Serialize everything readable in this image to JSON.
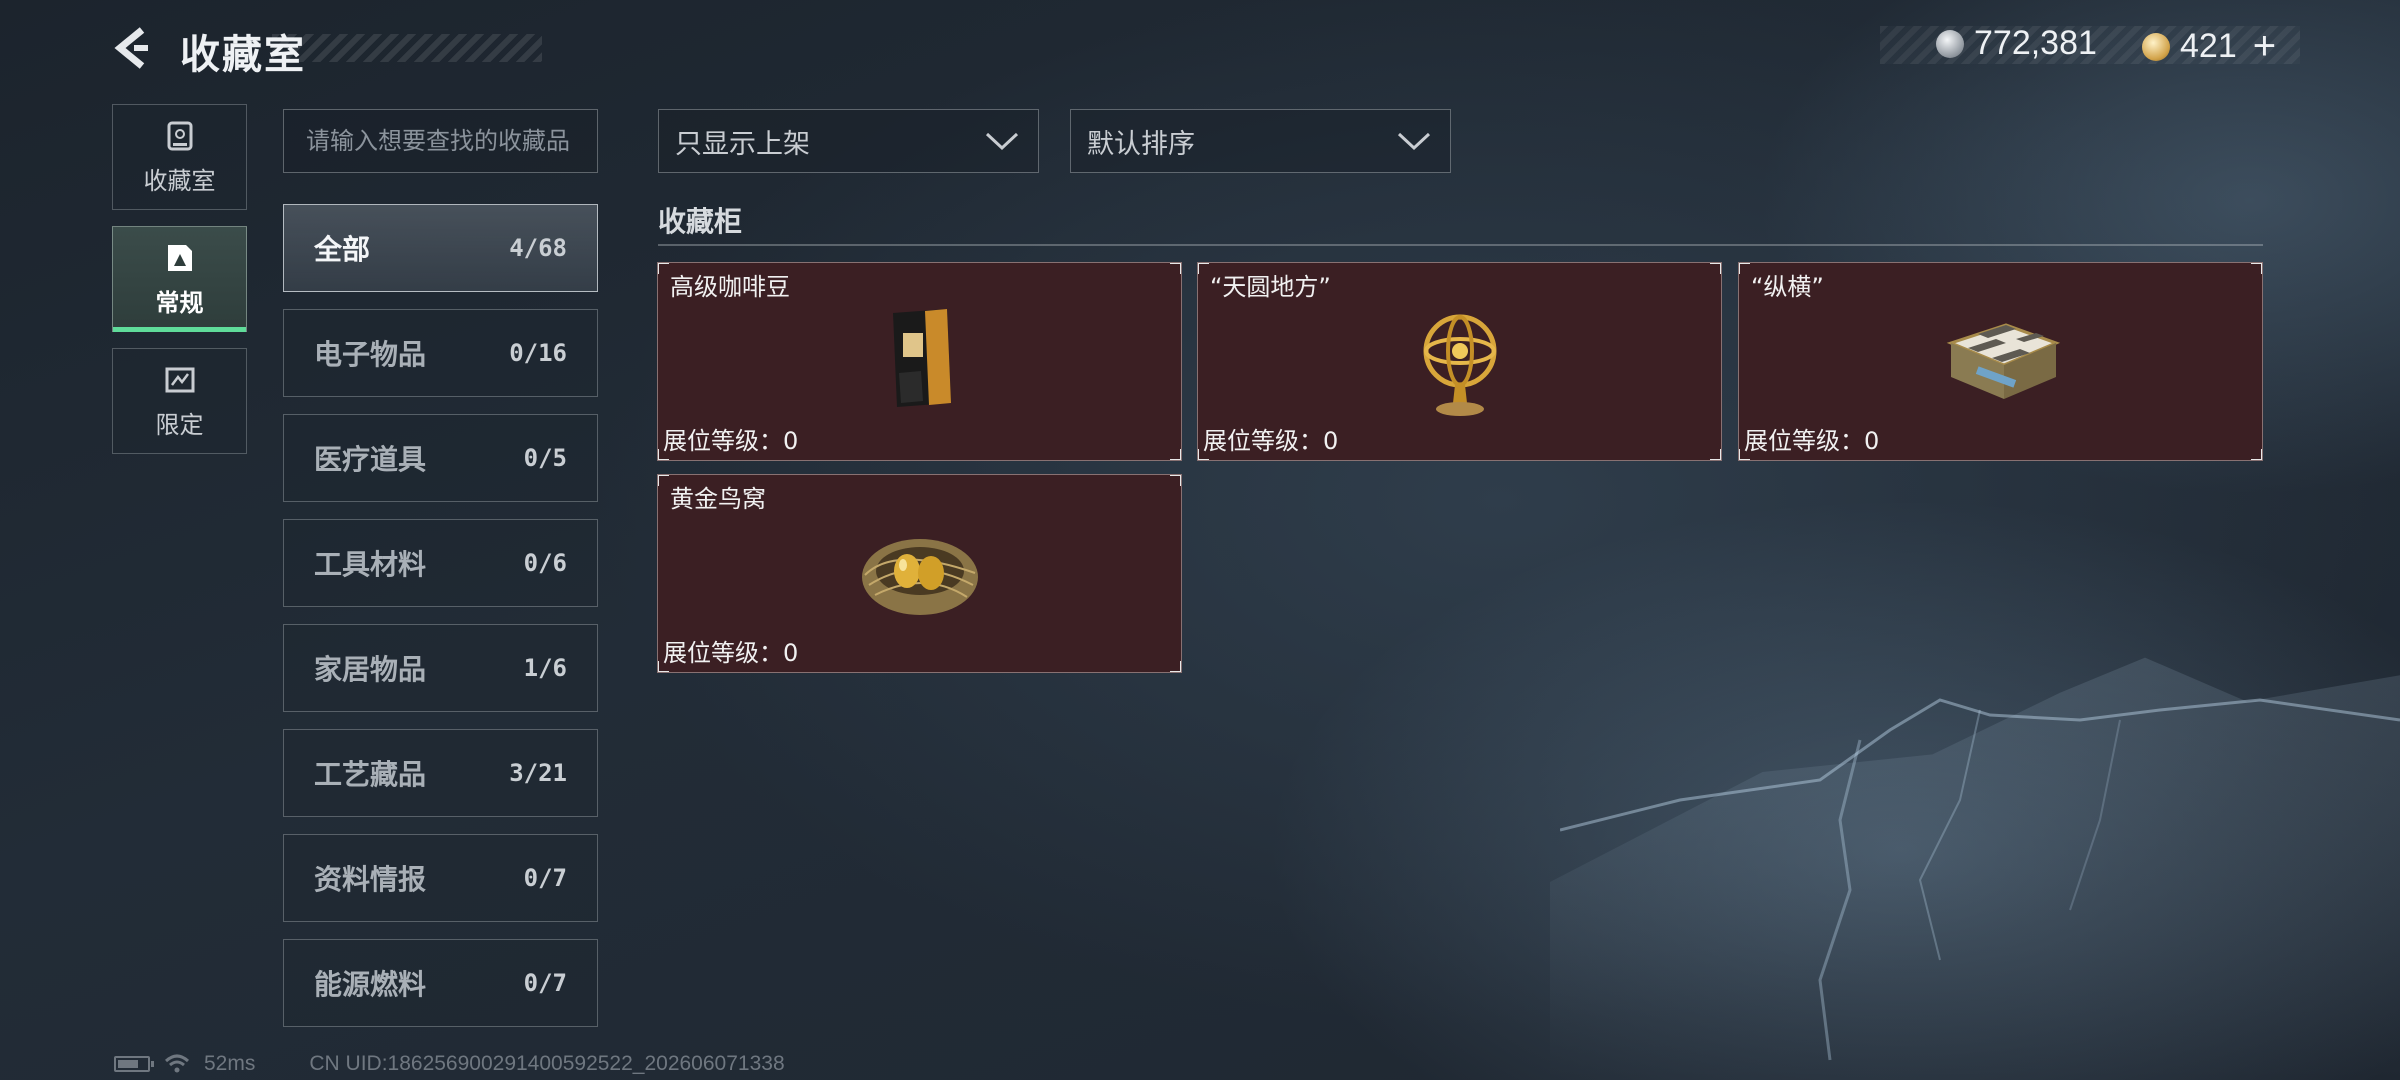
{
  "header": {
    "title": "收藏室",
    "currency": [
      {
        "icon": "silver-coin-icon",
        "value": "772,381"
      },
      {
        "icon": "gold-coin-icon",
        "value": "421"
      }
    ],
    "add_label": "+"
  },
  "nav": [
    {
      "label": "收藏室",
      "icon": "trophy-case-icon",
      "active": false
    },
    {
      "label": "常规",
      "icon": "regular-collection-icon",
      "active": true
    },
    {
      "label": "限定",
      "icon": "limited-collection-icon",
      "active": false
    }
  ],
  "search": {
    "placeholder": "请输入想要查找的收藏品"
  },
  "categories": [
    {
      "name": "全部",
      "count": "4/68",
      "active": true
    },
    {
      "name": "电子物品",
      "count": "0/16"
    },
    {
      "name": "医疗道具",
      "count": "0/5"
    },
    {
      "name": "工具材料",
      "count": "0/6"
    },
    {
      "name": "家居物品",
      "count": "1/6"
    },
    {
      "name": "工艺藏品",
      "count": "3/21"
    },
    {
      "name": "资料情报",
      "count": "0/7"
    },
    {
      "name": "能源燃料",
      "count": "0/7"
    }
  ],
  "filters": {
    "display_filter": "只显示上架",
    "sort": "默认排序"
  },
  "section_title": "收藏柜",
  "items": [
    {
      "name": "高级咖啡豆",
      "level": "展位等级：0",
      "icon": "coffee-bag-icon"
    },
    {
      "name": "“天圆地方”",
      "level": "展位等级：0",
      "icon": "armillary-sphere-icon"
    },
    {
      "name": "“纵横”",
      "level": "展位等级：0",
      "icon": "chessboard-box-icon"
    },
    {
      "name": "黄金鸟窝",
      "level": "展位等级：0",
      "icon": "golden-nest-icon"
    }
  ],
  "footer": {
    "ping": "52ms",
    "uid": "CN UID:1862569002914005925​22_202606071338"
  },
  "colors": {
    "card_bg": "#3b1f23",
    "active_accent": "#5fdc9a"
  }
}
